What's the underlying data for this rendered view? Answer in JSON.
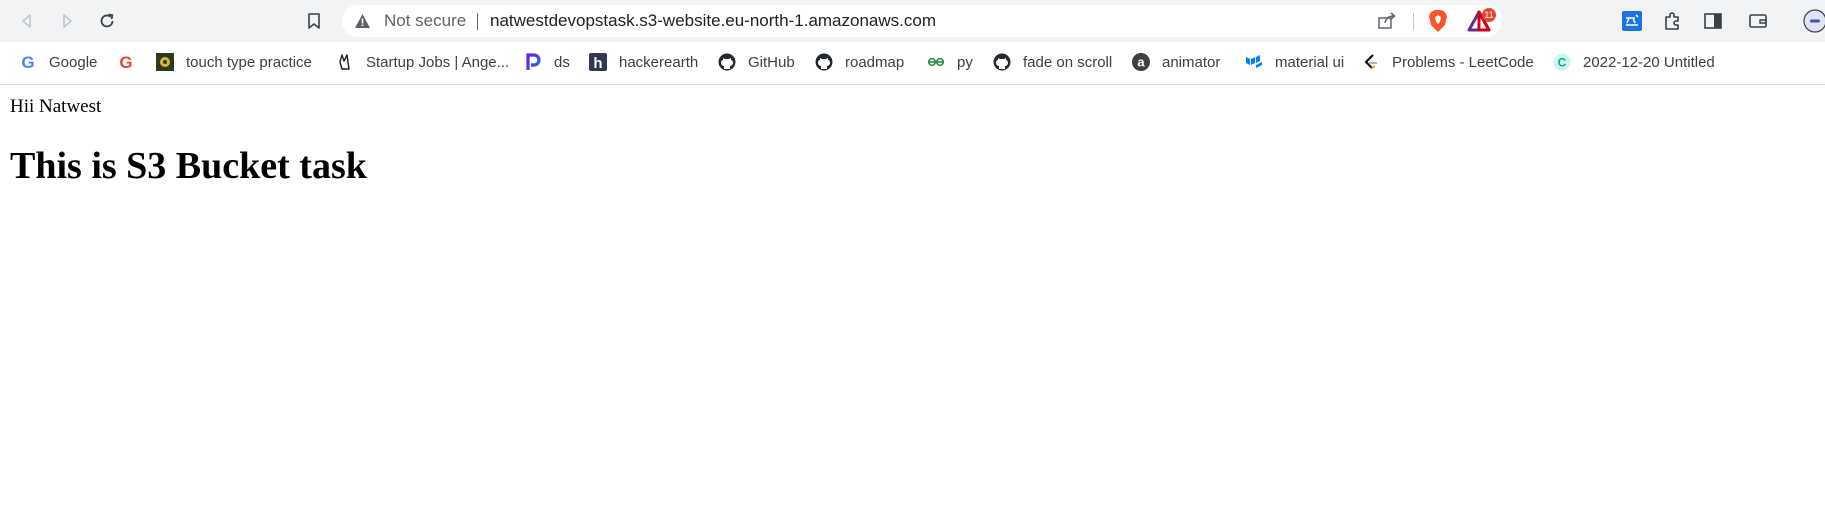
{
  "browser": {
    "security_label": "Not secure",
    "url": "natwestdevopstask.s3-website.eu-north-1.amazonaws.com",
    "notification_count": "11"
  },
  "bookmarks": [
    {
      "label": "Google",
      "icon": "google-icon"
    },
    {
      "label": "",
      "icon": "google-icon"
    },
    {
      "label": "touch type practice",
      "icon": "touch-type-icon"
    },
    {
      "label": "Startup Jobs | Ange...",
      "icon": "victory-hand-icon"
    },
    {
      "label": "ds",
      "icon": "ds-icon"
    },
    {
      "label": "hackerearth",
      "icon": "hackerearth-icon"
    },
    {
      "label": "GitHub",
      "icon": "github-icon"
    },
    {
      "label": "roadmap",
      "icon": "github-icon"
    },
    {
      "label": "py",
      "icon": "geeksforgeeks-icon"
    },
    {
      "label": "fade on scroll",
      "icon": "github-icon"
    },
    {
      "label": "animator",
      "icon": "animator-icon"
    },
    {
      "label": "material ui",
      "icon": "material-ui-icon"
    },
    {
      "label": "Problems - LeetCode",
      "icon": "leetcode-icon"
    },
    {
      "label": "2022-12-20 Untitled",
      "icon": "codepen-icon"
    }
  ],
  "page": {
    "greeting": "Hii Natwest",
    "heading": "This is S3 Bucket task"
  },
  "colors": {
    "toolbar_bg": "#f1f3f4",
    "brave_orange": "#fb542b",
    "github_dark": "#24292f"
  }
}
